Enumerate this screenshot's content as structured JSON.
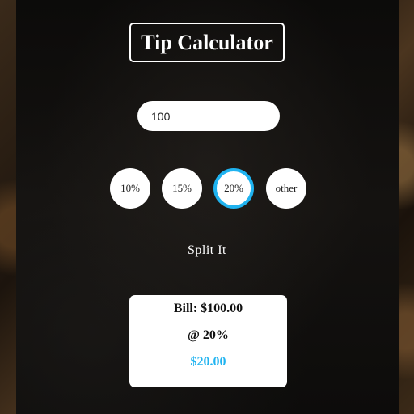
{
  "title": "Tip Calculator",
  "bill_input": {
    "value": "100"
  },
  "tip_options": [
    {
      "label": "10%",
      "selected": false
    },
    {
      "label": "15%",
      "selected": false
    },
    {
      "label": "20%",
      "selected": true
    },
    {
      "label": "other",
      "selected": false
    }
  ],
  "split_label": "Split It",
  "result": {
    "bill_text": "Bill: $100.00",
    "percent_text": "@ 20%",
    "tip_amount": "$20.00"
  },
  "colors": {
    "accent": "#1fb3f0",
    "panel": "#0c0b0a",
    "text_light": "#ffffff"
  }
}
